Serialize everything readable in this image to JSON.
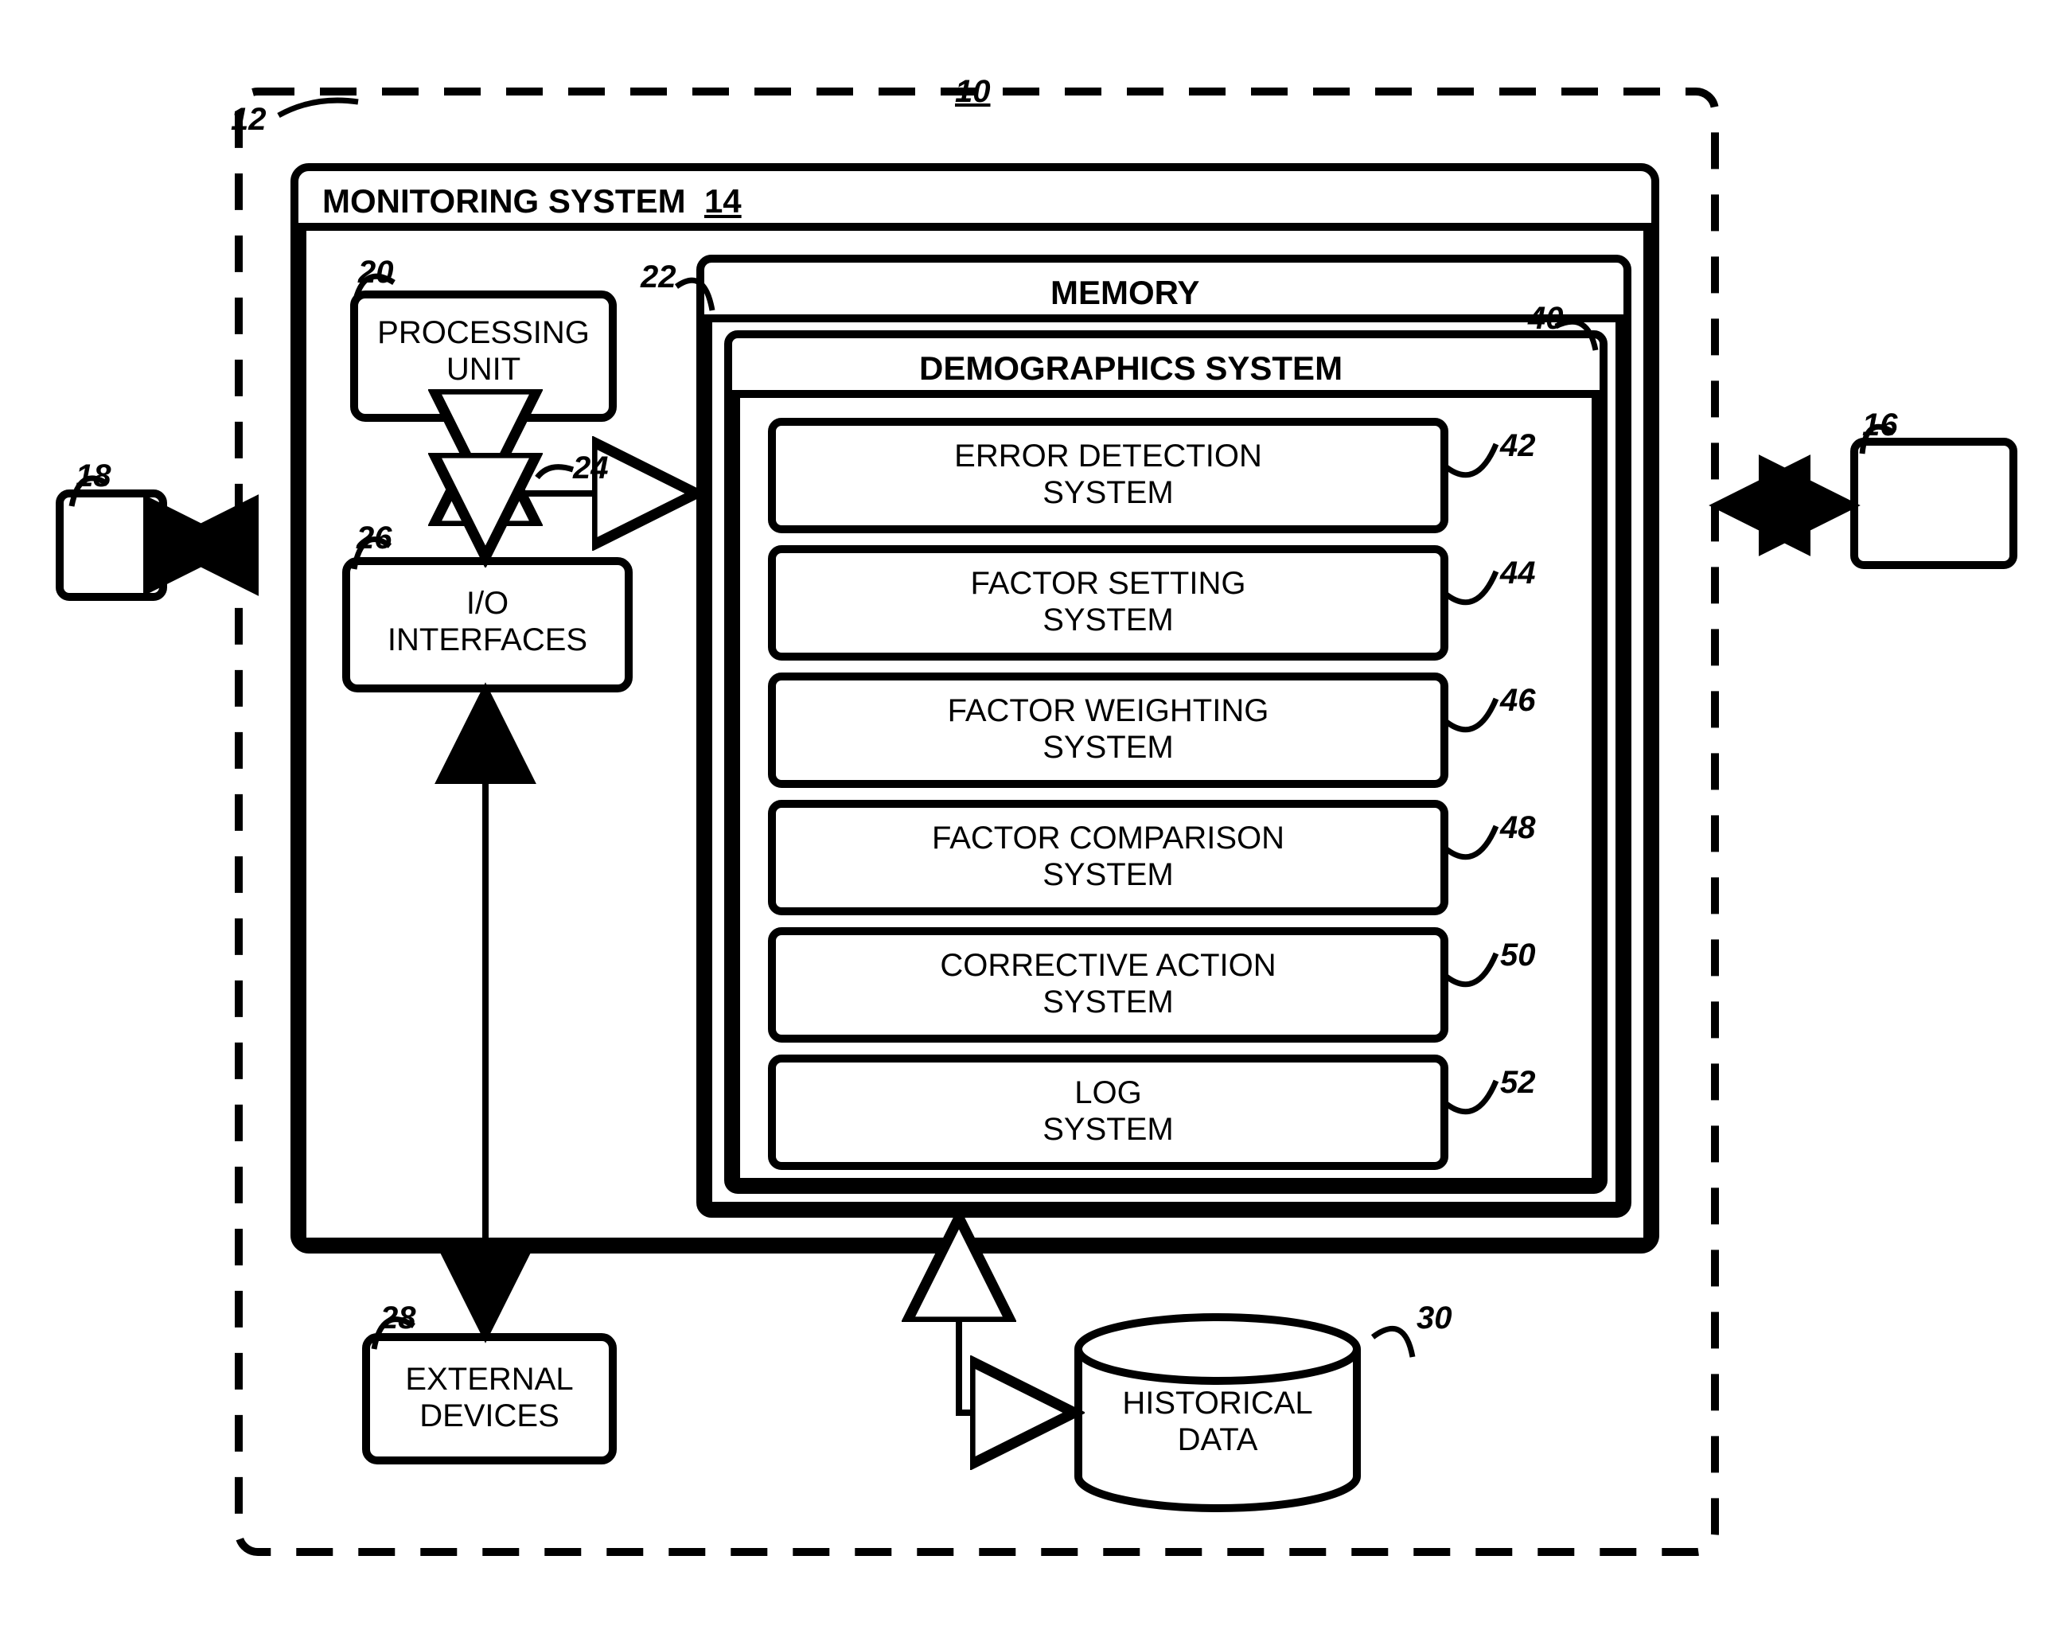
{
  "refs": {
    "r10": "10",
    "r12": "12",
    "r14": "14",
    "r16": "16",
    "r18": "18",
    "r20": "20",
    "r22": "22",
    "r24": "24",
    "r26": "26",
    "r28": "28",
    "r30": "30",
    "r40": "40",
    "r42": "42",
    "r44": "44",
    "r46": "46",
    "r48": "48",
    "r50": "50",
    "r52": "52"
  },
  "labels": {
    "monitoring": "MONITORING SYSTEM",
    "memory": "MEMORY",
    "processing_unit": "PROCESSING\nUNIT",
    "io_interfaces": "I/O\nINTERFACES",
    "demographics": "DEMOGRAPHICS SYSTEM",
    "error_detection": "ERROR DETECTION\nSYSTEM",
    "factor_setting": "FACTOR SETTING\nSYSTEM",
    "factor_weighting": "FACTOR WEIGHTING\nSYSTEM",
    "factor_comparison": "FACTOR COMPARISON\nSYSTEM",
    "corrective_action": "CORRECTIVE ACTION\nSYSTEM",
    "log_system": "LOG\nSYSTEM",
    "external_devices": "EXTERNAL\nDEVICES",
    "historical_data": "HISTORICAL\nDATA"
  }
}
